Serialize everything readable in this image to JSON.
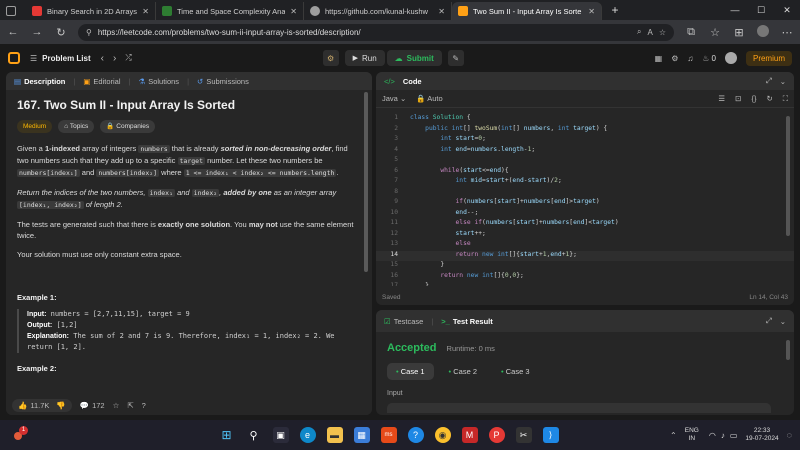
{
  "browser": {
    "tabs": [
      {
        "label": "",
        "fav_color": "#5f6368"
      },
      {
        "label": "Binary Search in 2D Arrays - You",
        "fav_color": "#e53935"
      },
      {
        "label": "Time and Space Complexity Anal",
        "fav_color": "#2e7d32"
      },
      {
        "label": "https://github.com/kunal-kushw",
        "fav_color": "#9e9e9e"
      },
      {
        "label": "Two Sum II - Input Array Is Sorte",
        "fav_color": "#ffa116"
      }
    ],
    "new_tab": "+",
    "window_controls": {
      "minimize": "—",
      "maximize": "☐",
      "close": "✕"
    },
    "url": "https://leetcode.com/problems/two-sum-ii-input-array-is-sorted/description/"
  },
  "lc_nav": {
    "problem_list": "Problem List",
    "run": "Run",
    "submit": "Submit",
    "streak": "0",
    "premium": "Premium"
  },
  "left": {
    "tabs": [
      "Description",
      "Editorial",
      "Solutions",
      "Submissions"
    ],
    "title": "167. Two Sum II - Input Array Is Sorted",
    "difficulty": "Medium",
    "topics": "Topics",
    "companies": "Companies",
    "p1_a": "Given a ",
    "p1_b": "1-indexed",
    "p1_c": " array of integers ",
    "p1_d": "numbers",
    "p1_e": " that is already ",
    "p1_f": "sorted in non-decreasing order",
    "p1_g": ", find two numbers such that they add up to a specific ",
    "p1_h": "target",
    "p1_i": " number. Let these two numbers be ",
    "p1_j": "numbers[index₁]",
    "p1_k": " and ",
    "p1_l": "numbers[index₂]",
    "p1_m": " where ",
    "p1_n": "1 <= index₁ < index₂ <= numbers.length",
    "p1_o": ".",
    "p2_a": "Return the indices of the two numbers, ",
    "p2_b": "index₁",
    "p2_c": " and ",
    "p2_d": "index₂",
    "p2_e": ", ",
    "p2_f": "added by one",
    "p2_g": " as an integer array ",
    "p2_h": "[index₁, index₂]",
    "p2_i": " of length 2.",
    "p3_a": "The tests are generated such that there is ",
    "p3_b": "exactly one solution",
    "p3_c": ". You ",
    "p3_d": "may not",
    "p3_e": " use the same element twice.",
    "p4": "Your solution must use only constant extra space.",
    "example1_title": "Example 1:",
    "ex1_input_label": "Input:",
    "ex1_input": " numbers = [2,7,11,15], target = 9",
    "ex1_output_label": "Output:",
    "ex1_output": " [1,2]",
    "ex1_expl_label": "Explanation:",
    "ex1_expl": " The sum of 2 and 7 is 9. Therefore, index₁ = 1, index₂ = 2. We return [1, 2].",
    "example2_title": "Example 2:",
    "likes": "11.7K",
    "comments": "172"
  },
  "editor": {
    "title": "Code",
    "language": "Java",
    "auto": "Auto",
    "status": "Saved",
    "cursor": "Ln 14, Col 43",
    "lines": [
      {
        "n": "1",
        "segs": [
          [
            "kw",
            "class "
          ],
          [
            "ty",
            "Solution "
          ],
          [
            "tx",
            "{"
          ]
        ]
      },
      {
        "n": "2",
        "segs": [
          [
            "tx",
            "    "
          ],
          [
            "kw",
            "public "
          ],
          [
            "kw",
            "int"
          ],
          [
            "tx",
            "[] "
          ],
          [
            "fn",
            "twoSum"
          ],
          [
            "tx",
            "("
          ],
          [
            "kw",
            "int"
          ],
          [
            "tx",
            "[] "
          ],
          [
            "vr",
            "numbers"
          ],
          [
            "tx",
            ", "
          ],
          [
            "kw",
            "int "
          ],
          [
            "vr",
            "target"
          ],
          [
            "tx",
            ") {"
          ]
        ]
      },
      {
        "n": "3",
        "segs": [
          [
            "tx",
            "        "
          ],
          [
            "kw",
            "int "
          ],
          [
            "vr",
            "start"
          ],
          [
            "tx",
            "="
          ],
          [
            "nm",
            "0"
          ],
          [
            "tx",
            ";"
          ]
        ]
      },
      {
        "n": "4",
        "segs": [
          [
            "tx",
            "        "
          ],
          [
            "kw",
            "int "
          ],
          [
            "vr",
            "end"
          ],
          [
            "tx",
            "="
          ],
          [
            "vr",
            "numbers"
          ],
          [
            "tx",
            "."
          ],
          [
            "vr",
            "length"
          ],
          [
            "tx",
            "-"
          ],
          [
            "nm",
            "1"
          ],
          [
            "tx",
            ";"
          ]
        ]
      },
      {
        "n": "5",
        "segs": []
      },
      {
        "n": "6",
        "segs": [
          [
            "tx",
            "        "
          ],
          [
            "pk",
            "while"
          ],
          [
            "tx",
            "("
          ],
          [
            "vr",
            "start"
          ],
          [
            "tx",
            "<="
          ],
          [
            "vr",
            "end"
          ],
          [
            "tx",
            "){"
          ]
        ]
      },
      {
        "n": "7",
        "segs": [
          [
            "tx",
            "            "
          ],
          [
            "kw",
            "int "
          ],
          [
            "vr",
            "mid"
          ],
          [
            "tx",
            "="
          ],
          [
            "vr",
            "start"
          ],
          [
            "tx",
            "+("
          ],
          [
            "vr",
            "end"
          ],
          [
            "tx",
            "-"
          ],
          [
            "vr",
            "start"
          ],
          [
            "tx",
            ")/"
          ],
          [
            "nm",
            "2"
          ],
          [
            "tx",
            ";"
          ]
        ]
      },
      {
        "n": "8",
        "segs": []
      },
      {
        "n": "9",
        "segs": [
          [
            "tx",
            "            "
          ],
          [
            "pk",
            "if"
          ],
          [
            "tx",
            "("
          ],
          [
            "vr",
            "numbers"
          ],
          [
            "tx",
            "["
          ],
          [
            "vr",
            "start"
          ],
          [
            "tx",
            "]+"
          ],
          [
            "vr",
            "numbers"
          ],
          [
            "tx",
            "["
          ],
          [
            "vr",
            "end"
          ],
          [
            "tx",
            "]>"
          ],
          [
            "vr",
            "target"
          ],
          [
            "tx",
            ")"
          ]
        ]
      },
      {
        "n": "10",
        "segs": [
          [
            "tx",
            "            "
          ],
          [
            "vr",
            "end"
          ],
          [
            "tx",
            "--;"
          ]
        ]
      },
      {
        "n": "11",
        "segs": [
          [
            "tx",
            "            "
          ],
          [
            "pk",
            "else if"
          ],
          [
            "tx",
            "("
          ],
          [
            "vr",
            "numbers"
          ],
          [
            "tx",
            "["
          ],
          [
            "vr",
            "start"
          ],
          [
            "tx",
            "]+"
          ],
          [
            "vr",
            "numbers"
          ],
          [
            "tx",
            "["
          ],
          [
            "vr",
            "end"
          ],
          [
            "tx",
            "]<"
          ],
          [
            "vr",
            "target"
          ],
          [
            "tx",
            ")"
          ]
        ]
      },
      {
        "n": "12",
        "segs": [
          [
            "tx",
            "            "
          ],
          [
            "vr",
            "start"
          ],
          [
            "tx",
            "++;"
          ]
        ]
      },
      {
        "n": "13",
        "segs": [
          [
            "tx",
            "            "
          ],
          [
            "pk",
            "else"
          ]
        ]
      },
      {
        "n": "14",
        "segs": [
          [
            "tx",
            "            "
          ],
          [
            "pk",
            "return "
          ],
          [
            "kw",
            "new "
          ],
          [
            "kw",
            "int"
          ],
          [
            "tx",
            "[]{"
          ],
          [
            "vr",
            "start"
          ],
          [
            "tx",
            "+"
          ],
          [
            "nm",
            "1"
          ],
          [
            "tx",
            ","
          ],
          [
            "vr",
            "end"
          ],
          [
            "tx",
            "+"
          ],
          [
            "nm",
            "1"
          ],
          [
            "tx",
            "};"
          ]
        ]
      },
      {
        "n": "15",
        "segs": [
          [
            "tx",
            "        }"
          ]
        ]
      },
      {
        "n": "16",
        "segs": [
          [
            "tx",
            "        "
          ],
          [
            "pk",
            "return "
          ],
          [
            "kw",
            "new "
          ],
          [
            "kw",
            "int"
          ],
          [
            "tx",
            "[]{"
          ],
          [
            "nm",
            "0"
          ],
          [
            "tx",
            ","
          ],
          [
            "nm",
            "0"
          ],
          [
            "tx",
            "};"
          ]
        ]
      },
      {
        "n": "17",
        "segs": [
          [
            "tx",
            "    }"
          ]
        ]
      }
    ]
  },
  "results": {
    "tabs": [
      "Testcase",
      "Test Result"
    ],
    "status": "Accepted",
    "runtime": "Runtime: 0 ms",
    "cases": [
      "Case 1",
      "Case 2",
      "Case 3"
    ],
    "input_label": "Input"
  },
  "taskbar": {
    "notification_badge": "1",
    "lang_line1": "ENG",
    "lang_line2": "IN",
    "time": "22:33",
    "date": "19-07-2024"
  },
  "colors": {
    "accent": "#ffa116",
    "accepted": "#2cbb5d",
    "submit": "#2cbb5d"
  }
}
